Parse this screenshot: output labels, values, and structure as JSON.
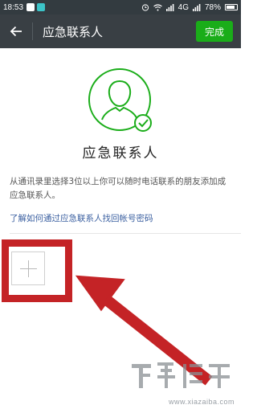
{
  "status_bar": {
    "time": "18:53",
    "network": "4G",
    "battery": "78%"
  },
  "nav": {
    "title": "应急联系人",
    "done_label": "完成"
  },
  "main": {
    "title": "应急联系人",
    "description": "从通讯录里选择3位以上你可以随时电话联系的朋友添加成应急联系人。",
    "help_link": "了解如何通过应急联系人找回帐号密码"
  },
  "watermark": {
    "url": "www.xiazaiba.com"
  },
  "colors": {
    "wechat_green": "#1aad19",
    "nav_bg": "#393f44",
    "status_bg": "#333b40",
    "highlight_red": "#c42326",
    "link_blue": "#3a5fa0"
  }
}
